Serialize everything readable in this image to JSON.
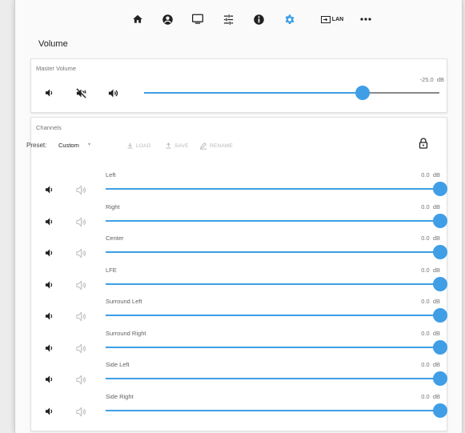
{
  "nav": {
    "items": [
      {
        "name": "home-icon",
        "active": false
      },
      {
        "name": "profile-icon",
        "active": false
      },
      {
        "name": "display-icon",
        "active": false
      },
      {
        "name": "equalizer-icon",
        "active": false
      },
      {
        "name": "info-icon",
        "active": false
      },
      {
        "name": "settings-gear-icon",
        "active": true
      },
      {
        "name": "input-lan-icon",
        "active": false
      },
      {
        "name": "more-icon",
        "active": false
      }
    ],
    "lan_label": "LAN",
    "active_color": "#3f9ee6"
  },
  "page": {
    "title": "Volume"
  },
  "master": {
    "title": "Master Volume",
    "db_value": "-25.0",
    "db_unit": "dB",
    "level": 0.74,
    "icons": [
      "volume-down-icon",
      "volume-mute-icon",
      "volume-up-icon"
    ]
  },
  "channels": {
    "title": "Channels",
    "preset_label": "Preset:",
    "preset_value": "Custom",
    "load_label": "LOAD",
    "save_label": "SAVE",
    "rename_label": "RENAME",
    "list": [
      {
        "name": "Left",
        "db": "0.0",
        "unit": "dB",
        "level": 1.0
      },
      {
        "name": "Right",
        "db": "0.0",
        "unit": "dB",
        "level": 1.0
      },
      {
        "name": "Center",
        "db": "0.0",
        "unit": "dB",
        "level": 1.0
      },
      {
        "name": "LFE",
        "db": "0.0",
        "unit": "dB",
        "level": 1.0
      },
      {
        "name": "Surround Left",
        "db": "0.0",
        "unit": "dB",
        "level": 1.0
      },
      {
        "name": "Surround Right",
        "db": "0.0",
        "unit": "dB",
        "level": 1.0
      },
      {
        "name": "Side Left",
        "db": "0.0",
        "unit": "dB",
        "level": 1.0
      },
      {
        "name": "Side Right",
        "db": "0.0",
        "unit": "dB",
        "level": 1.0
      }
    ]
  }
}
